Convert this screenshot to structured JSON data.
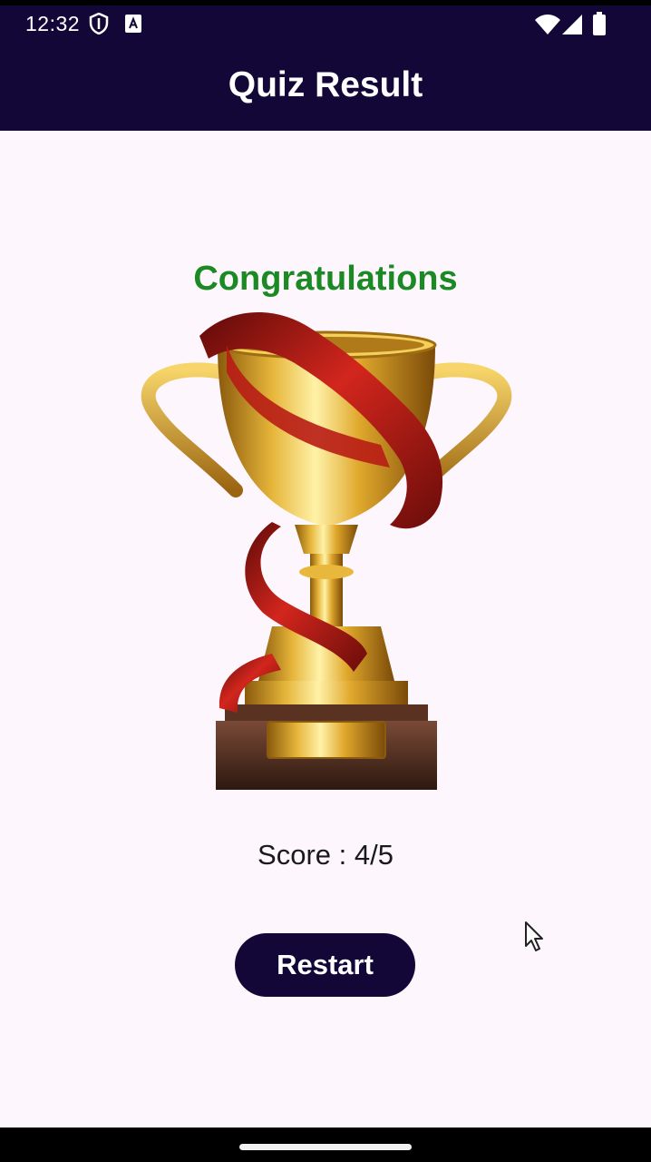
{
  "status_bar": {
    "time": "12:32",
    "icons": [
      "shield-icon",
      "font-a-icon",
      "wifi-icon",
      "signal-icon",
      "battery-icon"
    ]
  },
  "app_bar": {
    "title": "Quiz Result"
  },
  "result": {
    "heading": "Congratulations",
    "image": "trophy-icon",
    "score_text": "Score : 4/5"
  },
  "actions": {
    "restart_label": "Restart"
  },
  "colors": {
    "app_bar": "#130738",
    "background": "#fdf7fd",
    "heading_green": "#1b8a24",
    "button": "#130738",
    "gold": "#d9a520",
    "ribbon_red": "#a3140f"
  }
}
